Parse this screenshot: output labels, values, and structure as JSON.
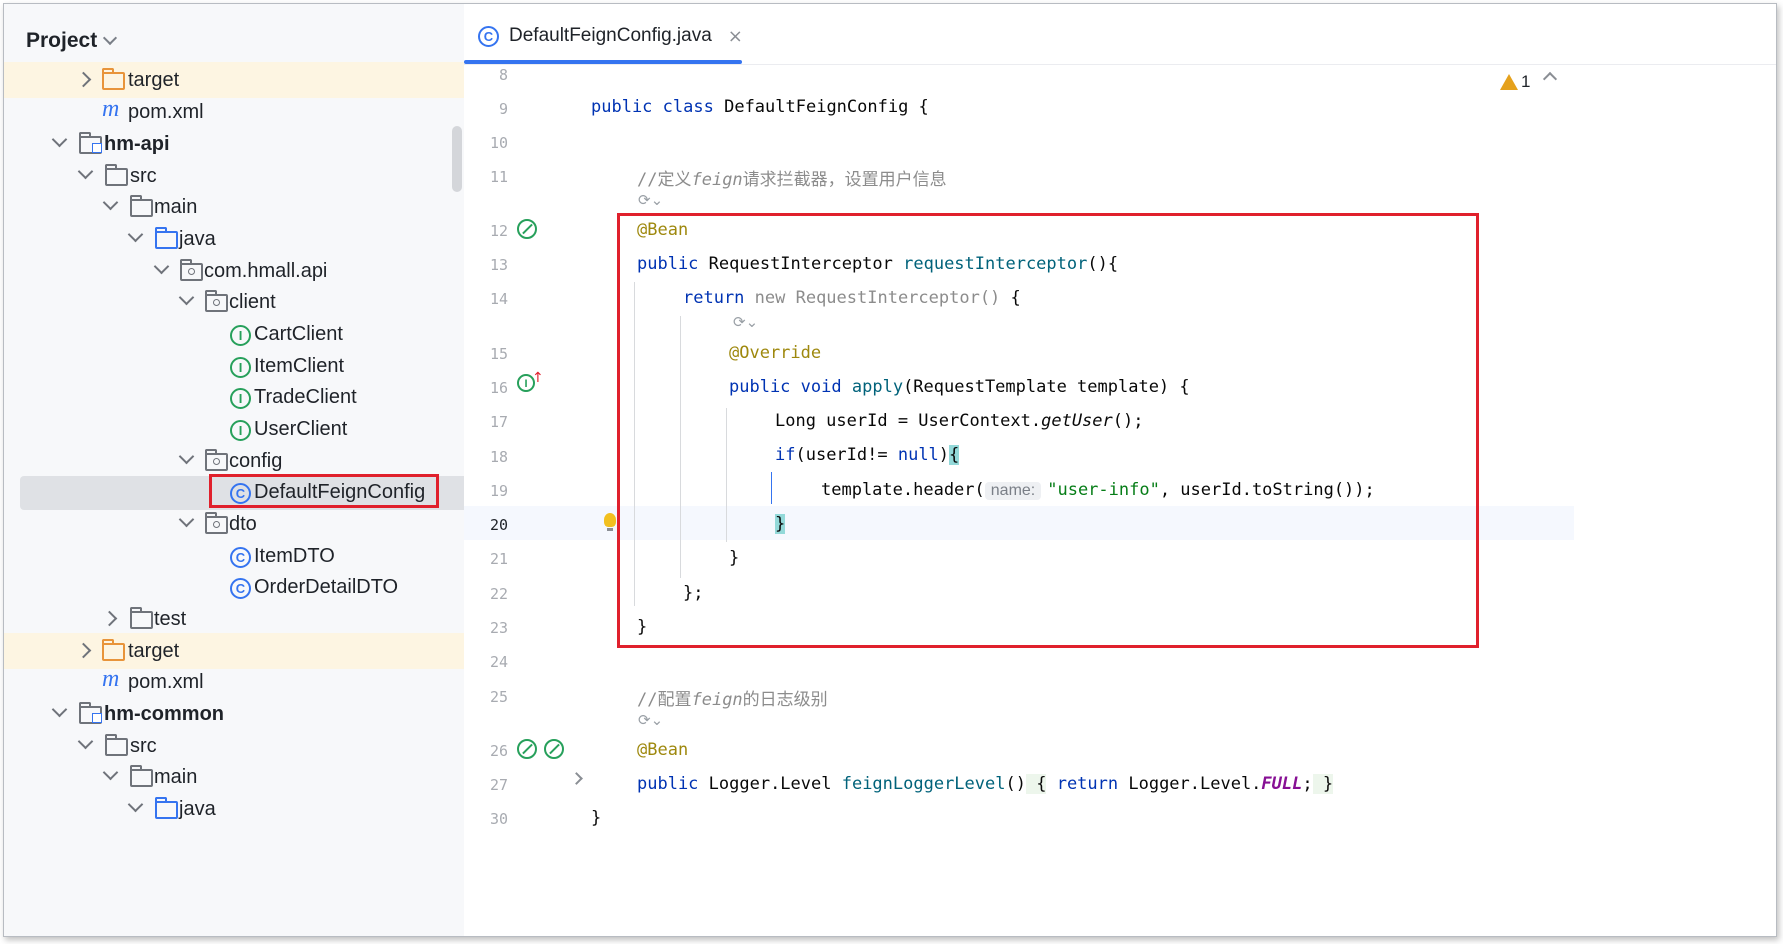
{
  "project_panel": {
    "title": "Project",
    "tree": [
      {
        "label": "target",
        "type": "folder-excluded",
        "expanded": false
      },
      {
        "label": "pom.xml",
        "type": "maven"
      },
      {
        "label": "hm-api",
        "type": "module",
        "expanded": true
      },
      {
        "label": "src",
        "type": "folder",
        "expanded": true
      },
      {
        "label": "main",
        "type": "folder",
        "expanded": true
      },
      {
        "label": "java",
        "type": "source-root",
        "expanded": true
      },
      {
        "label": "com.hmall.api",
        "type": "package",
        "expanded": true
      },
      {
        "label": "client",
        "type": "package",
        "expanded": true
      },
      {
        "label": "CartClient",
        "type": "interface"
      },
      {
        "label": "ItemClient",
        "type": "interface"
      },
      {
        "label": "TradeClient",
        "type": "interface"
      },
      {
        "label": "UserClient",
        "type": "interface"
      },
      {
        "label": "config",
        "type": "package",
        "expanded": true
      },
      {
        "label": "DefaultFeignConfig",
        "type": "class",
        "selected": true
      },
      {
        "label": "dto",
        "type": "package",
        "expanded": true
      },
      {
        "label": "ItemDTO",
        "type": "class"
      },
      {
        "label": "OrderDetailDTO",
        "type": "class"
      },
      {
        "label": "test",
        "type": "folder",
        "expanded": false
      },
      {
        "label": "target",
        "type": "folder-excluded",
        "expanded": false
      },
      {
        "label": "pom.xml",
        "type": "maven"
      },
      {
        "label": "hm-common",
        "type": "module",
        "expanded": true
      },
      {
        "label": "src",
        "type": "folder",
        "expanded": true
      },
      {
        "label": "main",
        "type": "folder",
        "expanded": true
      },
      {
        "label": "java",
        "type": "source-root",
        "expanded": true
      }
    ]
  },
  "editor": {
    "tab": {
      "label": "DefaultFeignConfig.java",
      "close": "×"
    },
    "warnings_count": "1",
    "line_numbers": [
      "8",
      "9",
      "10",
      "11",
      "12",
      "13",
      "14",
      "15",
      "16",
      "17",
      "18",
      "19",
      "20",
      "21",
      "22",
      "23",
      "24",
      "25",
      "26",
      "27",
      "30"
    ],
    "current_line": "20",
    "code": {
      "l9": {
        "kw1": "public",
        "kw2": "class",
        "name": " DefaultFeignConfig {"
      },
      "l11": {
        "slashes": "//",
        "c1": "定义",
        "c2": "feign",
        "c3": "请求拦截器，设置用户信息"
      },
      "l12": {
        "ann": "@Bean"
      },
      "l13": {
        "kw": "public",
        "type": " RequestInterceptor ",
        "fn": "requestInterceptor",
        "rest": "(){"
      },
      "l14": {
        "kw": "return",
        "gray": " new RequestInterceptor()",
        "rest": " {"
      },
      "l15": {
        "ann": "@Override"
      },
      "l16": {
        "kw1": "public",
        "kw2": "void",
        "fn": "apply",
        "rest": "(RequestTemplate template) {"
      },
      "l17": {
        "a": "Long userId = UserContext.",
        "it": "getUser",
        "b": "();"
      },
      "l18": {
        "kw": "if",
        "a": "(userId!= ",
        "kw2": "null",
        "b": ")",
        "brace": "{"
      },
      "l19": {
        "a": "template.header(",
        "hint": "name:",
        "str": "\"user-info\"",
        "b": ", userId.toString());"
      },
      "l20": {
        "brace": "}"
      },
      "l21": {
        "a": "}"
      },
      "l22": {
        "a": "};"
      },
      "l23": {
        "a": "}"
      },
      "l25": {
        "slashes": "//",
        "c1": "配置",
        "c2": "feign",
        "c3": "的日志级别"
      },
      "l26": {
        "ann": "@Bean"
      },
      "l27": {
        "kw": "public",
        "type": " Logger.Level ",
        "fn": "feignLoggerLevel",
        "paren": "()",
        "b1": " {",
        "kw2": "return",
        "a": " Logger.Level.",
        "const": "FULL",
        "semi": ";",
        "b2": " }"
      },
      "l30": {
        "a": "}"
      }
    },
    "ai_hint": "⟳⌄"
  }
}
